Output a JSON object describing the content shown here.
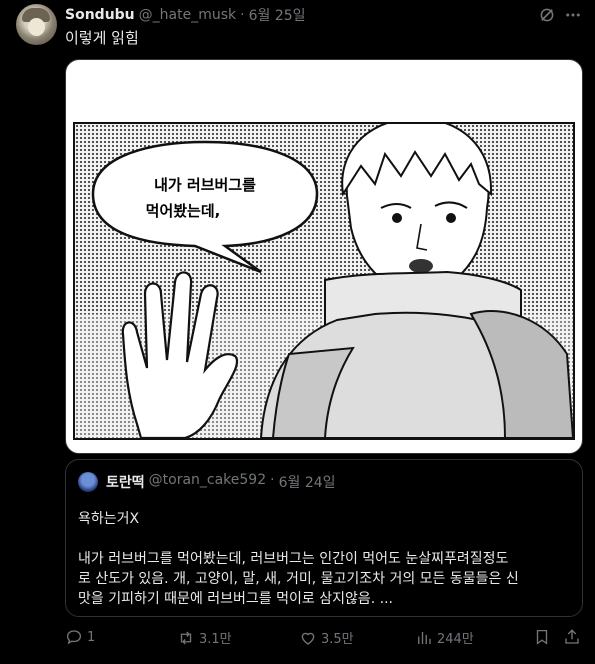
{
  "tweet": {
    "author_name": "Sondubu",
    "handle": "@_hate_musk",
    "separator": "·",
    "date": "6월 25일",
    "text": "이렇게 읽힘"
  },
  "media": {
    "speech_line1": "내가 러브버그를",
    "speech_line2": "먹어봤는데,"
  },
  "quote": {
    "author_name": "토란떡",
    "handle": "@toran_cake592",
    "separator": "·",
    "date": "6월 24일",
    "line1": "욕하는거X",
    "line2": "내가 러브버그를 먹어봤는데, 러브버그는 인간이 먹어도 눈살찌푸려질정도",
    "line3": "로 산도가 있음. 개, 고양이, 말, 새, 거미, 물고기조차 거의 모든 동물들은 신",
    "line4": "맛을 기피하기 때문에 러브버그를 먹이로 삼지않음. ..."
  },
  "actions": {
    "replies": "1",
    "reposts": "3.1만",
    "likes": "3.5만",
    "views": "244만"
  },
  "icons": [
    "grok-icon",
    "more-icon",
    "reply-icon",
    "repost-icon",
    "like-icon",
    "views-icon",
    "bookmark-icon",
    "share-icon"
  ]
}
